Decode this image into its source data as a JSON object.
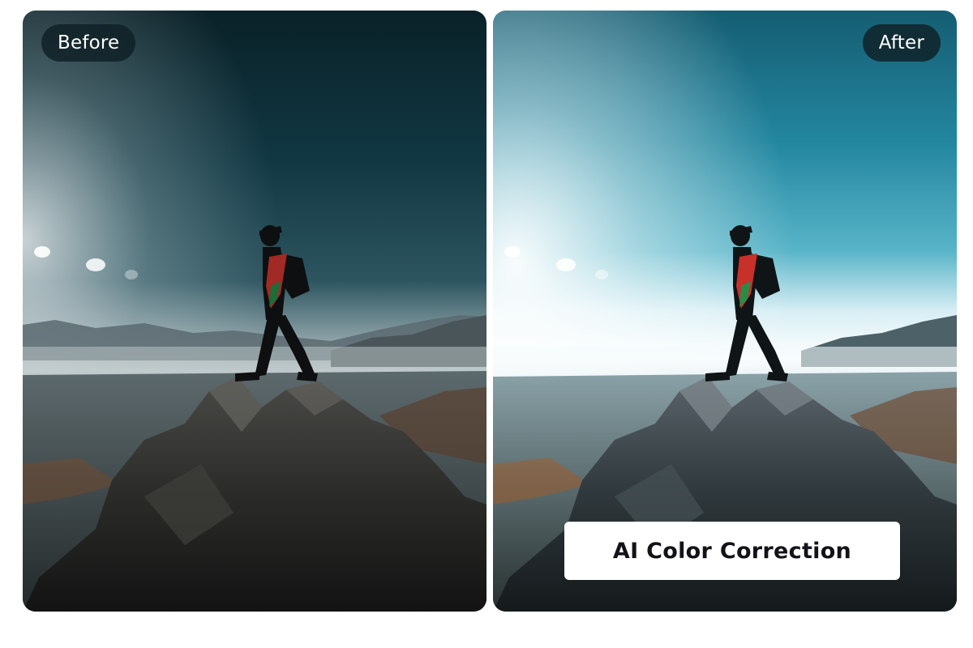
{
  "comparison": {
    "before_label": "Before",
    "after_label": "After",
    "feature_caption": "AI Color Correction"
  },
  "colors": {
    "before_sky_top": "#0b2a33",
    "before_sky_horizon": "#9fb0b4",
    "after_sky_top": "#1b6a80",
    "after_sky_horizon": "#eaf6fa",
    "pill_background": "#0f2026",
    "caption_background": "#ffffff"
  }
}
